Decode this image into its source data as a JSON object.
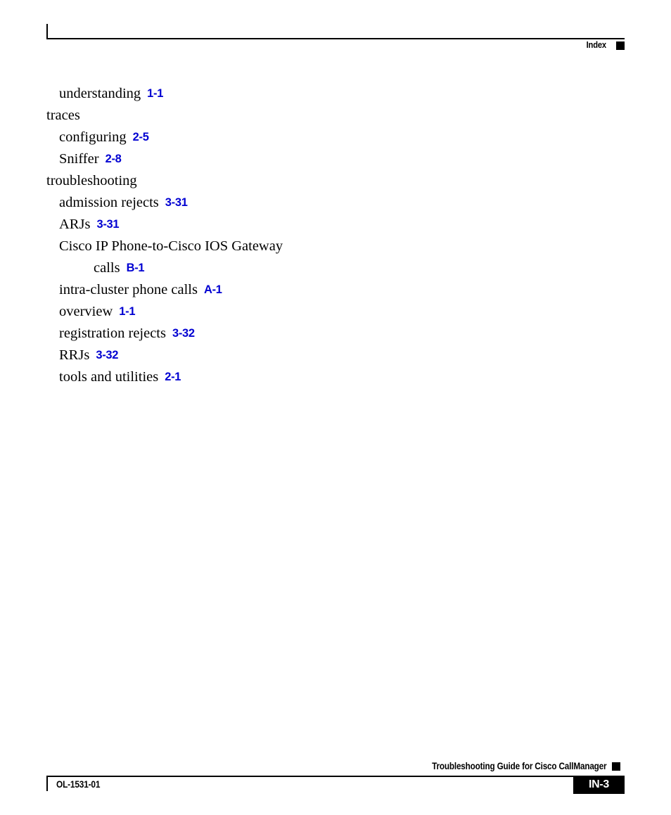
{
  "header": {
    "title": "Index",
    "marker_icon": "black-square-marker"
  },
  "index": {
    "entries": [
      {
        "level": 2,
        "term": "understanding",
        "ref": "1-1"
      },
      {
        "level": 1,
        "term": "traces",
        "ref": ""
      },
      {
        "level": 2,
        "term": "configuring",
        "ref": "2-5"
      },
      {
        "level": 2,
        "term": "Sniffer",
        "ref": "2-8"
      },
      {
        "level": 1,
        "term": "troubleshooting",
        "ref": ""
      },
      {
        "level": 2,
        "term": "admission rejects",
        "ref": "3-31"
      },
      {
        "level": 2,
        "term": "ARJs",
        "ref": "3-31"
      },
      {
        "level": 2,
        "term": "Cisco IP Phone-to-Cisco IOS Gateway",
        "ref": ""
      },
      {
        "level": 3,
        "term": "calls",
        "ref": "B-1"
      },
      {
        "level": 2,
        "term": "intra-cluster phone calls",
        "ref": "A-1"
      },
      {
        "level": 2,
        "term": "overview",
        "ref": "1-1"
      },
      {
        "level": 2,
        "term": "registration rejects",
        "ref": "3-32"
      },
      {
        "level": 2,
        "term": "RRJs",
        "ref": "3-32"
      },
      {
        "level": 2,
        "term": "tools and utilities",
        "ref": "2-1"
      }
    ]
  },
  "footer": {
    "guide_title": "Troubleshooting Guide for Cisco CallManager",
    "doc_number": "OL-1531-01",
    "page_number": "IN-3",
    "marker_icon": "black-square-marker"
  },
  "colors": {
    "page_reference": "#0000D2",
    "rule": "#000000",
    "page_box": "#000000",
    "page_box_text": "#ffffff"
  }
}
